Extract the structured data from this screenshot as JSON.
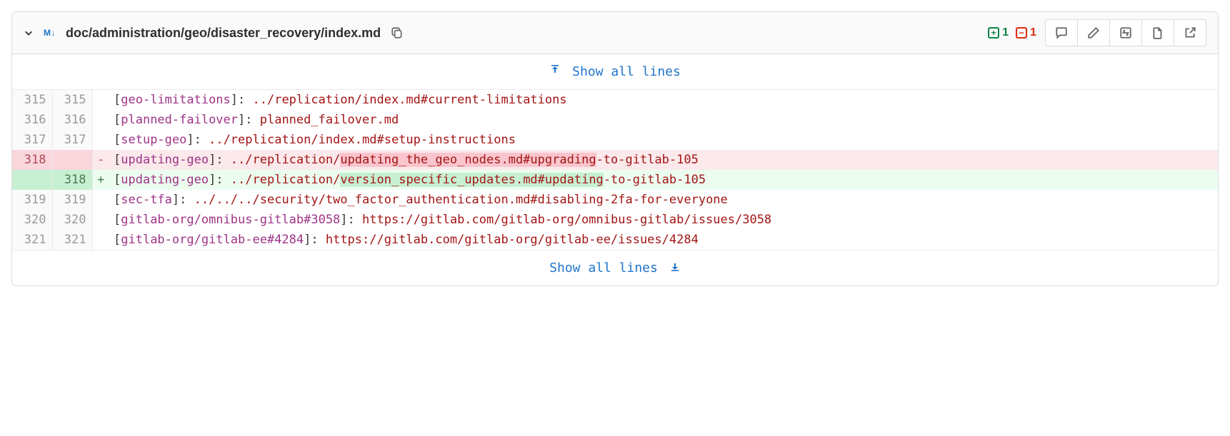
{
  "header": {
    "md_badge": "M↓",
    "file_path": "doc/administration/geo/disaster_recovery/index.md",
    "additions_count": "1",
    "deletions_count": "1"
  },
  "expand": {
    "top_label": "Show all lines",
    "bottom_label": "Show all lines"
  },
  "diff": {
    "rows": [
      {
        "type": "context",
        "old": "315",
        "new": "315",
        "sign": " ",
        "segments": [
          {
            "t": "[",
            "c": "tk-bracket"
          },
          {
            "t": "geo-limitations",
            "c": "tk-link"
          },
          {
            "t": "]: ",
            "c": "tk-colon"
          },
          {
            "t": "../replication/index.md#current-limitations",
            "c": "tk-url"
          }
        ]
      },
      {
        "type": "context",
        "old": "316",
        "new": "316",
        "sign": " ",
        "segments": [
          {
            "t": "[",
            "c": "tk-bracket"
          },
          {
            "t": "planned-failover",
            "c": "tk-link"
          },
          {
            "t": "]: ",
            "c": "tk-colon"
          },
          {
            "t": "planned_failover.md",
            "c": "tk-url"
          }
        ]
      },
      {
        "type": "context",
        "old": "317",
        "new": "317",
        "sign": " ",
        "segments": [
          {
            "t": "[",
            "c": "tk-bracket"
          },
          {
            "t": "setup-geo",
            "c": "tk-link"
          },
          {
            "t": "]: ",
            "c": "tk-colon"
          },
          {
            "t": "../replication/index.md#setup-instructions",
            "c": "tk-url"
          }
        ]
      },
      {
        "type": "deletion",
        "old": "318",
        "new": "",
        "sign": "-",
        "segments": [
          {
            "t": "[",
            "c": "tk-bracket"
          },
          {
            "t": "updating-geo",
            "c": "tk-link"
          },
          {
            "t": "]: ",
            "c": "tk-colon"
          },
          {
            "t": "../replication/",
            "c": "tk-url"
          },
          {
            "t": "updating_the_geo_nodes.md#upgrading",
            "c": "tk-url hl-del"
          },
          {
            "t": "-to-gitlab-105",
            "c": "tk-url"
          }
        ]
      },
      {
        "type": "addition",
        "old": "",
        "new": "318",
        "sign": "+",
        "segments": [
          {
            "t": "[",
            "c": "tk-bracket"
          },
          {
            "t": "updating-geo",
            "c": "tk-link"
          },
          {
            "t": "]: ",
            "c": "tk-colon"
          },
          {
            "t": "../replication/",
            "c": "tk-url"
          },
          {
            "t": "version_specific_updates.md#updating",
            "c": "tk-url hl-add"
          },
          {
            "t": "-to-gitlab-105",
            "c": "tk-url"
          }
        ]
      },
      {
        "type": "context",
        "old": "319",
        "new": "319",
        "sign": " ",
        "segments": [
          {
            "t": "[",
            "c": "tk-bracket"
          },
          {
            "t": "sec-tfa",
            "c": "tk-link"
          },
          {
            "t": "]: ",
            "c": "tk-colon"
          },
          {
            "t": "../../../security/two_factor_authentication.md#disabling-2fa-for-everyone",
            "c": "tk-url"
          }
        ]
      },
      {
        "type": "context",
        "old": "320",
        "new": "320",
        "sign": " ",
        "segments": [
          {
            "t": "[",
            "c": "tk-bracket"
          },
          {
            "t": "gitlab-org/omnibus-gitlab#3058",
            "c": "tk-link"
          },
          {
            "t": "]: ",
            "c": "tk-colon"
          },
          {
            "t": "https://gitlab.com/gitlab-org/omnibus-gitlab/issues/3058",
            "c": "tk-url"
          }
        ]
      },
      {
        "type": "context",
        "old": "321",
        "new": "321",
        "sign": " ",
        "segments": [
          {
            "t": "[",
            "c": "tk-bracket"
          },
          {
            "t": "gitlab-org/gitlab-ee#4284",
            "c": "tk-link"
          },
          {
            "t": "]: ",
            "c": "tk-colon"
          },
          {
            "t": "https://gitlab.com/gitlab-org/gitlab-ee/issues/4284",
            "c": "tk-url"
          }
        ]
      }
    ]
  }
}
